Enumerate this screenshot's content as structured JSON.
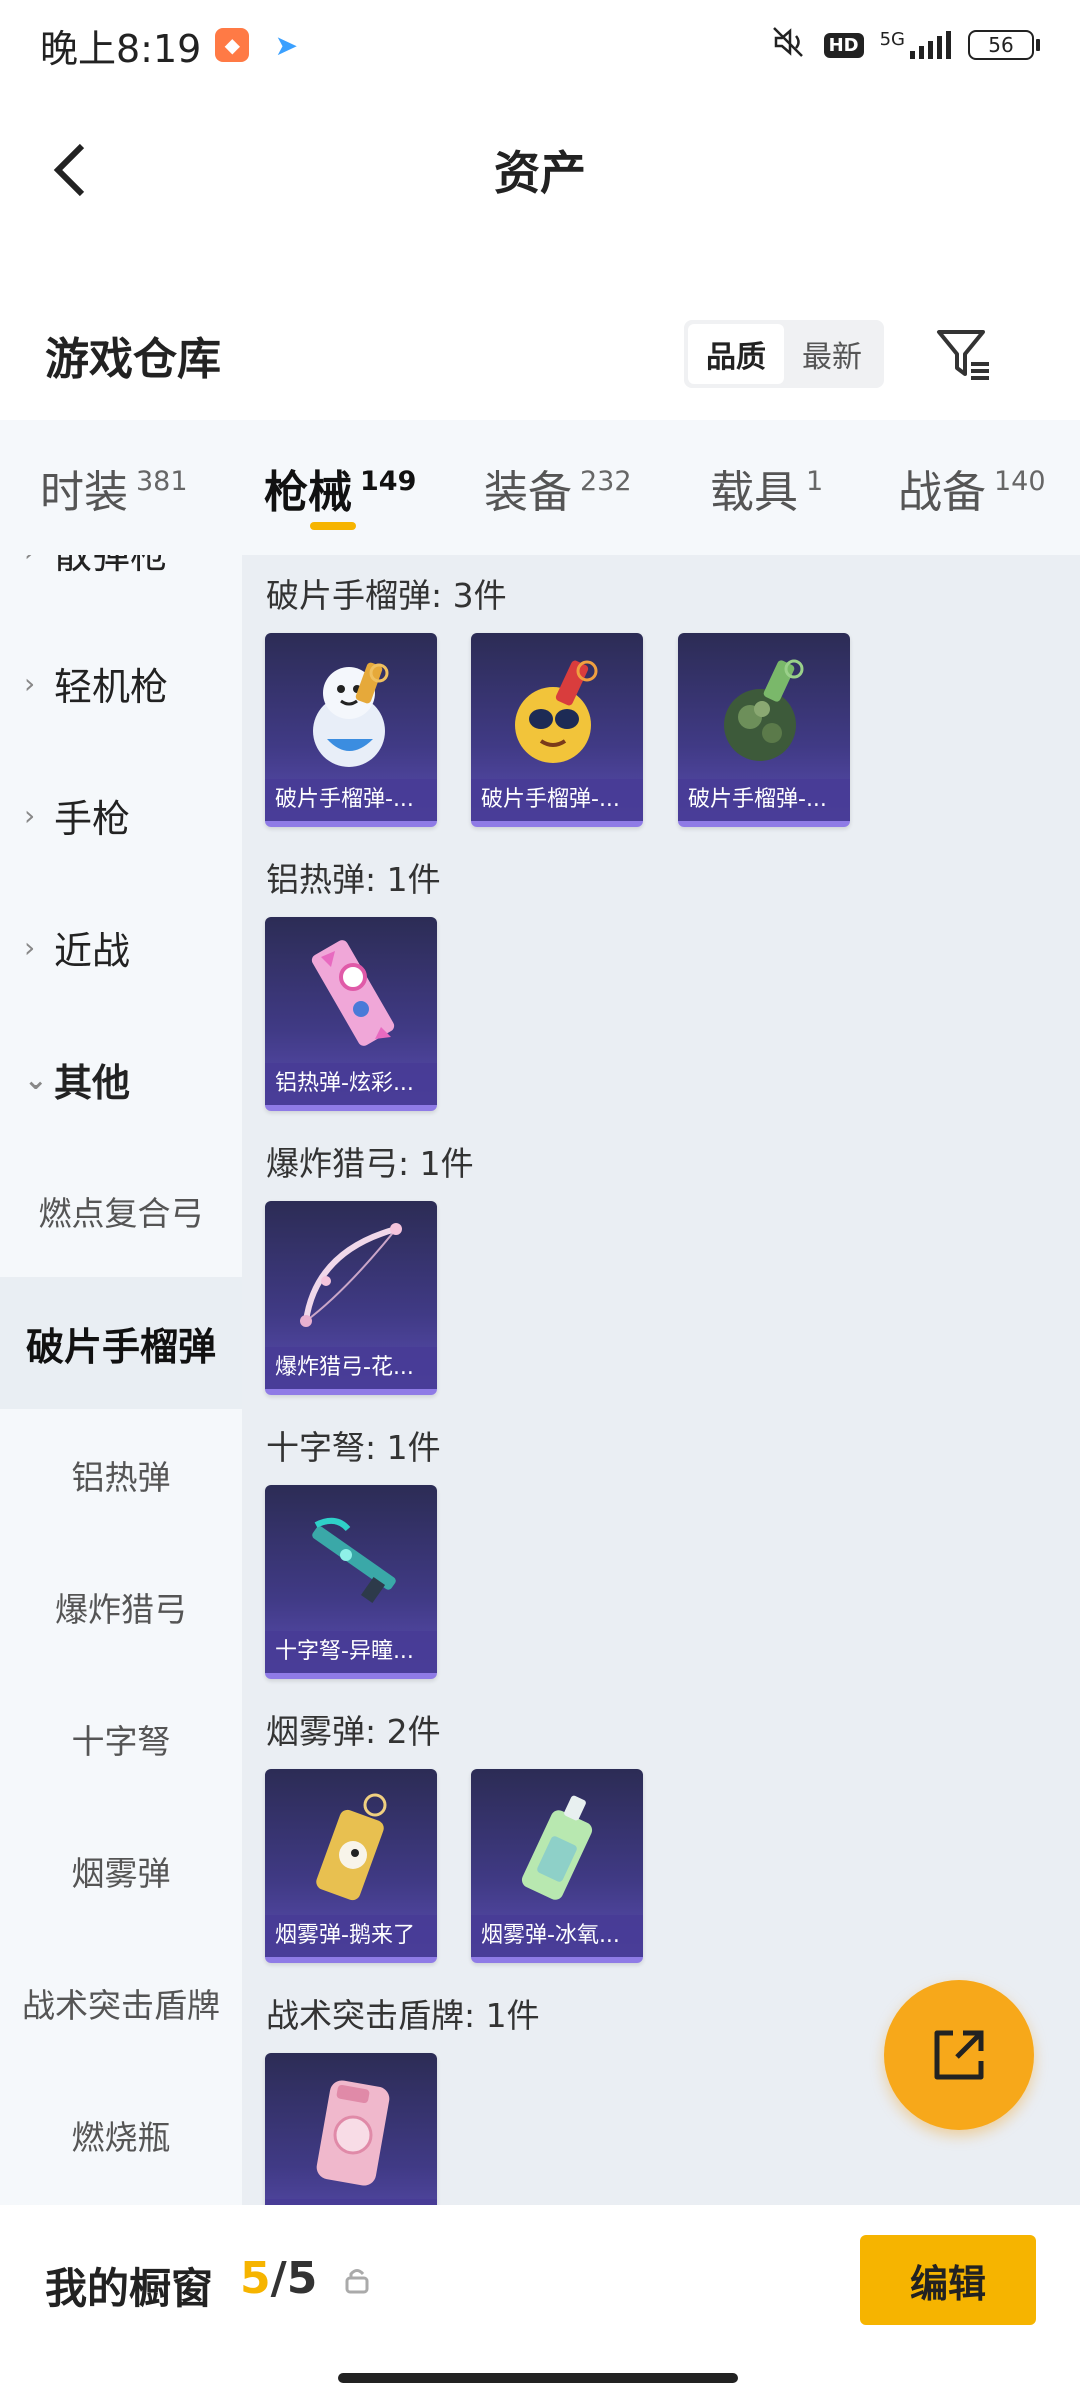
{
  "status_bar": {
    "time": "晚上8:19",
    "hd": "HD",
    "network": "5G",
    "battery": "56"
  },
  "header": {
    "title": "资产"
  },
  "warehouse": {
    "title": "游戏仓库",
    "sort_options": [
      "品质",
      "最新"
    ],
    "active_sort": "品质"
  },
  "tabs": [
    {
      "label": "时装",
      "count": "381"
    },
    {
      "label": "枪械",
      "count": "149"
    },
    {
      "label": "装备",
      "count": "232"
    },
    {
      "label": "载具",
      "count": "1"
    },
    {
      "label": "战备",
      "count": "140"
    }
  ],
  "active_tab": "枪械",
  "sidebar": {
    "categories": [
      {
        "label": "散弹枪"
      },
      {
        "label": "轻机枪"
      },
      {
        "label": "手枪"
      },
      {
        "label": "近战"
      },
      {
        "label": "其他"
      }
    ],
    "subitems": [
      {
        "label": "燃点复合弓"
      },
      {
        "label": "破片手榴弹"
      },
      {
        "label": "铝热弹"
      },
      {
        "label": "爆炸猎弓"
      },
      {
        "label": "十字弩"
      },
      {
        "label": "烟雾弹"
      },
      {
        "label": "战术突击盾牌"
      },
      {
        "label": "燃烧瓶"
      }
    ],
    "active_subitem": "破片手榴弹"
  },
  "sections": [
    {
      "title": "破片手榴弹: 3件",
      "items": [
        "破片手榴弹-...",
        "破片手榴弹-...",
        "破片手榴弹-..."
      ]
    },
    {
      "title": "铝热弹: 1件",
      "items": [
        "铝热弹-炫彩..."
      ]
    },
    {
      "title": "爆炸猎弓: 1件",
      "items": [
        "爆炸猎弓-花..."
      ]
    },
    {
      "title": "十字弩: 1件",
      "items": [
        "十字弩-异瞳..."
      ]
    },
    {
      "title": "烟雾弹: 2件",
      "items": [
        "烟雾弹-鹅来了",
        "烟雾弹-冰氧..."
      ]
    },
    {
      "title": "战术突击盾牌: 1件",
      "items": [
        ""
      ]
    }
  ],
  "showcase": {
    "title": "我的橱窗",
    "current": "5",
    "separator": "/",
    "max": "5",
    "edit_label": "编辑"
  },
  "colors": {
    "accent": "#f6b400",
    "fab": "#f7a81a",
    "card_top": "#2c2c55",
    "card_bottom": "#5a4db0"
  }
}
